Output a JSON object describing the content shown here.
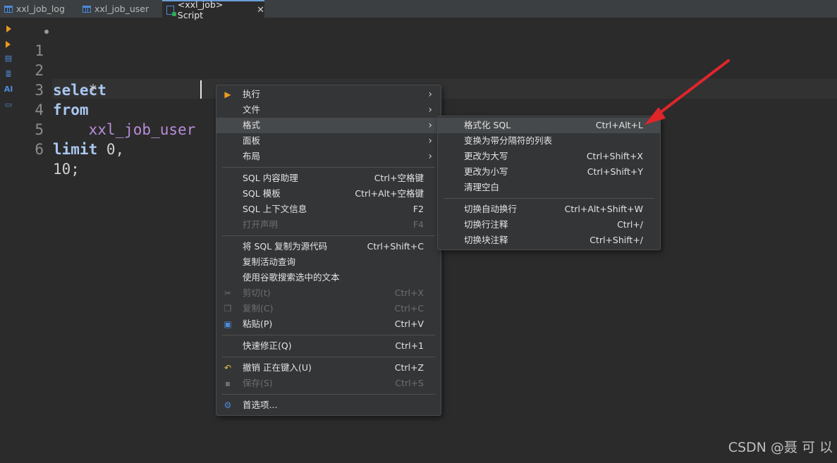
{
  "tabs": [
    {
      "label": "xxl_job_log"
    },
    {
      "label": "xxl_job_user"
    },
    {
      "label": "<xxl_job> Script"
    }
  ],
  "editor": {
    "lines": [
      {
        "num": "1",
        "text": "select"
      },
      {
        "num": "2",
        "text": "    *"
      },
      {
        "num": "3",
        "text": "from"
      },
      {
        "num": "4",
        "text": "    xxl_job_user"
      },
      {
        "num": "5",
        "text": "limit 0,"
      },
      {
        "num": "6",
        "text": "10;"
      }
    ],
    "kw_limit": "limit",
    "num_part": " 0,"
  },
  "sidebar": {
    "ai_label": "AI"
  },
  "context_menu": {
    "items": [
      {
        "label": "执行",
        "shortcut": ""
      },
      {
        "label": "文件",
        "shortcut": ""
      },
      {
        "label": "格式",
        "shortcut": ""
      },
      {
        "label": "面板",
        "shortcut": ""
      },
      {
        "label": "布局",
        "shortcut": ""
      },
      {
        "label": "SQL 内容助理",
        "shortcut": "Ctrl+空格键"
      },
      {
        "label": "SQL 模板",
        "shortcut": "Ctrl+Alt+空格键"
      },
      {
        "label": "SQL 上下文信息",
        "shortcut": "F2"
      },
      {
        "label": "打开声明",
        "shortcut": "F4"
      },
      {
        "label": "将 SQL 复制为源代码",
        "shortcut": "Ctrl+Shift+C"
      },
      {
        "label": "复制活动查询",
        "shortcut": ""
      },
      {
        "label": "使用谷歌搜索选中的文本",
        "shortcut": ""
      },
      {
        "label": "剪切(t)",
        "shortcut": "Ctrl+X"
      },
      {
        "label": "复制(C)",
        "shortcut": "Ctrl+C"
      },
      {
        "label": "粘贴(P)",
        "shortcut": "Ctrl+V"
      },
      {
        "label": "快速修正(Q)",
        "shortcut": "Ctrl+1"
      },
      {
        "label": "撤销 正在键入(U)",
        "shortcut": "Ctrl+Z"
      },
      {
        "label": "保存(S)",
        "shortcut": "Ctrl+S"
      },
      {
        "label": "首选项...",
        "shortcut": ""
      }
    ]
  },
  "format_submenu": {
    "items": [
      {
        "label": "格式化 SQL",
        "shortcut": "Ctrl+Alt+L"
      },
      {
        "label": "变换为带分隔符的列表",
        "shortcut": ""
      },
      {
        "label": "更改为大写",
        "shortcut": "Ctrl+Shift+X"
      },
      {
        "label": "更改为小写",
        "shortcut": "Ctrl+Shift+Y"
      },
      {
        "label": "清理空白",
        "shortcut": ""
      },
      {
        "label": "切换自动换行",
        "shortcut": "Ctrl+Alt+Shift+W"
      },
      {
        "label": "切换行注释",
        "shortcut": "Ctrl+/"
      },
      {
        "label": "切换块注释",
        "shortcut": "Ctrl+Shift+/"
      }
    ]
  },
  "watermark": "CSDN @聂 可 以",
  "colors": {
    "annotation_arrow": "#e0252b",
    "keyword": "#a9c7f0",
    "identifier": "#b98dd9"
  }
}
